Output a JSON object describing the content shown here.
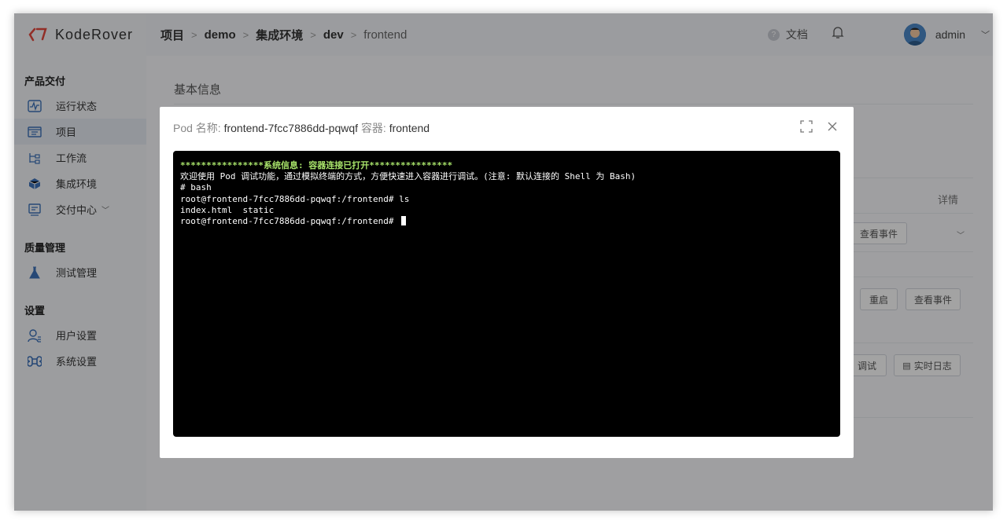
{
  "brand": {
    "name": "KodeRover"
  },
  "sidebar": {
    "groups": [
      {
        "heading": "产品交付",
        "items": [
          {
            "label": "运行状态",
            "icon": "pulse-icon"
          },
          {
            "label": "项目",
            "icon": "folder-icon",
            "active": true
          },
          {
            "label": "工作流",
            "icon": "workflow-icon"
          },
          {
            "label": "集成环境",
            "icon": "cube-icon"
          },
          {
            "label": "交付中心",
            "icon": "delivery-icon",
            "expandable": true
          }
        ]
      },
      {
        "heading": "质量管理",
        "items": [
          {
            "label": "测试管理",
            "icon": "flask-icon"
          }
        ]
      },
      {
        "heading": "设置",
        "items": [
          {
            "label": "用户设置",
            "icon": "user-settings-icon"
          },
          {
            "label": "系统设置",
            "icon": "command-icon"
          }
        ]
      }
    ]
  },
  "breadcrumb": [
    "项目",
    "demo",
    "集成环境",
    "dev",
    "frontend"
  ],
  "header": {
    "docs_label": "文档",
    "username": "admin"
  },
  "background": {
    "section_title": "基本信息",
    "details_label": "详情",
    "events_button": "查看事件",
    "restart_button": "重启",
    "events_button_2": "查看事件",
    "debug_button": "调试",
    "logs_button": "实时日志"
  },
  "modal": {
    "pod_label": "Pod 名称:",
    "pod_name": "frontend-7fcc7886dd-pqwqf",
    "container_label": "容器:",
    "container_name": "frontend",
    "terminal_lines": [
      "****************系统信息: 容器连接已打开****************",
      "欢迎使用 Pod 调试功能，通过模拟终端的方式，方便快速进入容器进行调试。(注意: 默认连接的 Shell 为 Bash)",
      "# bash",
      "root@frontend-7fcc7886dd-pqwqf:/frontend# ls",
      "index.html  static",
      "root@frontend-7fcc7886dd-pqwqf:/frontend# "
    ]
  },
  "colors": {
    "terminal_bg": "#000000",
    "terminal_green": "#a8e36a",
    "brand_red": "#e0473c"
  }
}
